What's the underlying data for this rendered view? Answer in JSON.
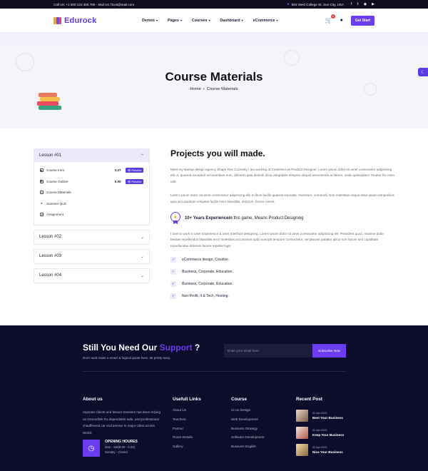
{
  "topbar": {
    "contact": "Call Us: +1 800 123 456 789 - Mail Us: ftcos@mail.com",
    "address": "684 West College St. Sun City, USA",
    "socials": [
      "f",
      "t",
      "ig",
      "yt"
    ]
  },
  "header": {
    "logo_text": "Edurock",
    "nav": [
      "Demos",
      "Pages",
      "Courses",
      "Dashboard",
      "eCommerce"
    ],
    "cart_count": "0",
    "cta": "Get Start"
  },
  "hero": {
    "title": "Course Materials",
    "breadcrumb_home": "Home",
    "breadcrumb_current": "Course Materials"
  },
  "sidebar": {
    "open_lesson": "Lesson #01",
    "items": [
      {
        "name": "Course Intro",
        "duration": "3.27",
        "preview": "Preview",
        "icon": "video-icon"
      },
      {
        "name": "Course Outline",
        "duration": "5.00",
        "preview": "Preview",
        "icon": "video-icon"
      },
      {
        "name": "Course Materials",
        "icon": "document-icon"
      },
      {
        "name": "Summer Quiz",
        "icon": "quiz-icon"
      },
      {
        "name": "Assignment",
        "icon": "assignment-icon"
      }
    ],
    "closed_lessons": [
      "Lesson #02",
      "Lesson #03",
      "Lesson #04"
    ]
  },
  "content": {
    "title": "Projects you will made.",
    "para1": "Meet my startup design agency Shape Rex Currently I am working at CodeNext as Product Designer. Lorem ipsum dolor sit amet consectetur adipisicing elit. A, quaerat excepturi accusantium eum, dolorem ipsa deleniti dicta voluptates tempore aliquid assumenda at labore, unde quibusdam! Tenetur hic enim odit.",
    "para2": "Lorem ipsum dolor, sit amet consectetur adipisicing elit. In illum facilis quaerat expedita. Inventore, commodi. Non molestias neque esse ipsam temporibus quia accusantium voluptas facilis enim blanditiis, dolorum, facere omnis.",
    "experience_bold": "10+ Years Experiencein",
    "experience_rest": " this game, Means Product Designing",
    "para3": "I love to work in User Experience & User Interface designing. Lorem ipsum dolor sit amet consectetur adipisicing elit. Provident quod, maxime dolor beatae repellendus blanditiis error molestias accusamus optio suscipit tempore consectetur, vel placeat pariatur alicui non harum sed cupiditate repudiandae dolorum facere repellat fugit.",
    "checks": [
      "eCommerce design, Creative.",
      "Business, Corporate, Education.",
      "Business, Corporate, Education.",
      "Non-Profit, It & Tech, Hosting."
    ]
  },
  "newsletter": {
    "title_start": "Still You Need Our ",
    "title_accent": "Support",
    "title_end": " ?",
    "subtitle": "Don't wait make a smart & logical quote here. Its pretty easy.",
    "placeholder": "Enter your email here",
    "button": "Subscribe Now"
  },
  "footer": {
    "about_title": "About us",
    "about_text": "orporate clients and leisure travelers has been relying on Groundlink for dependable safe, and professional chauffeured car end service in major cities across World.",
    "hours_title": "OPENING HOURES",
    "hours_line1": "Mon - Sat(8.00 - 6.00)",
    "hours_line2": "Sunday - Closed",
    "links_title": "Usefull Links",
    "links": [
      "About Us",
      "Teachers",
      "Partner",
      "Room-Details",
      "Gallery"
    ],
    "course_title": "Course",
    "courses": [
      "UI Ux Design",
      "Web Development",
      "Business Strategy",
      "Software Development",
      "Business English"
    ],
    "recent_title": "Recent Post",
    "posts": [
      {
        "date": "02 Apr 2023",
        "title": "Best Your Business"
      },
      {
        "date": "02 Apr 2023",
        "title": "Keep Your Business"
      },
      {
        "date": "02 Apr 2023",
        "title": "Nice Your Business"
      }
    ]
  },
  "colors": {
    "accent": "#6c3df0",
    "footer_bg": "#0d0c2b",
    "topbar_bg": "#0e0e1f"
  }
}
